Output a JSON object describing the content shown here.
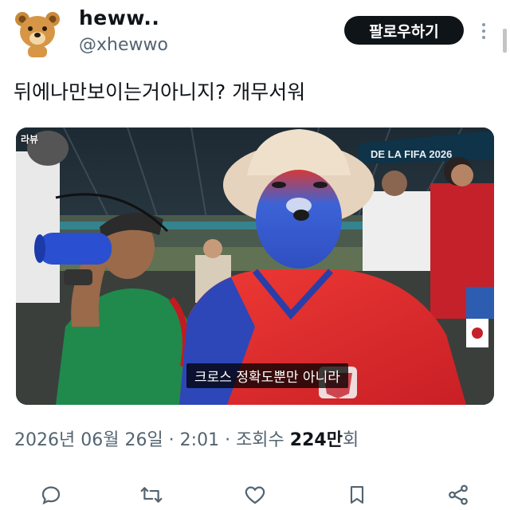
{
  "author": {
    "display_name": "heww..",
    "handle": "@xhewwo",
    "avatar_icon": "bear-avatar-icon"
  },
  "follow_button": {
    "label": "팔로우하기"
  },
  "tweet": {
    "text": "뒤에나만보이는거아니지?  개무서워"
  },
  "media": {
    "channel_logo": "라뷰",
    "subtitle": "크로스 정확도뿐만 아니라",
    "banner_text": "DE LA FIFA 2026"
  },
  "meta": {
    "date": "2026년 06월 26일",
    "separator": " · ",
    "time": "2:01",
    "views_label": "조회수 ",
    "views_count": "224만",
    "views_suffix": "회"
  },
  "actions": {
    "reply_icon": "reply-icon",
    "retweet_icon": "retweet-icon",
    "like_icon": "heart-icon",
    "bookmark_icon": "bookmark-icon",
    "share_icon": "share-icon"
  },
  "colors": {
    "text_primary": "#0f1419",
    "text_secondary": "#536471",
    "button_bg": "#0f1419",
    "korea_red": "#e4262c",
    "korea_blue": "#3a5fd9",
    "mexico_green": "#1f8a4c"
  }
}
